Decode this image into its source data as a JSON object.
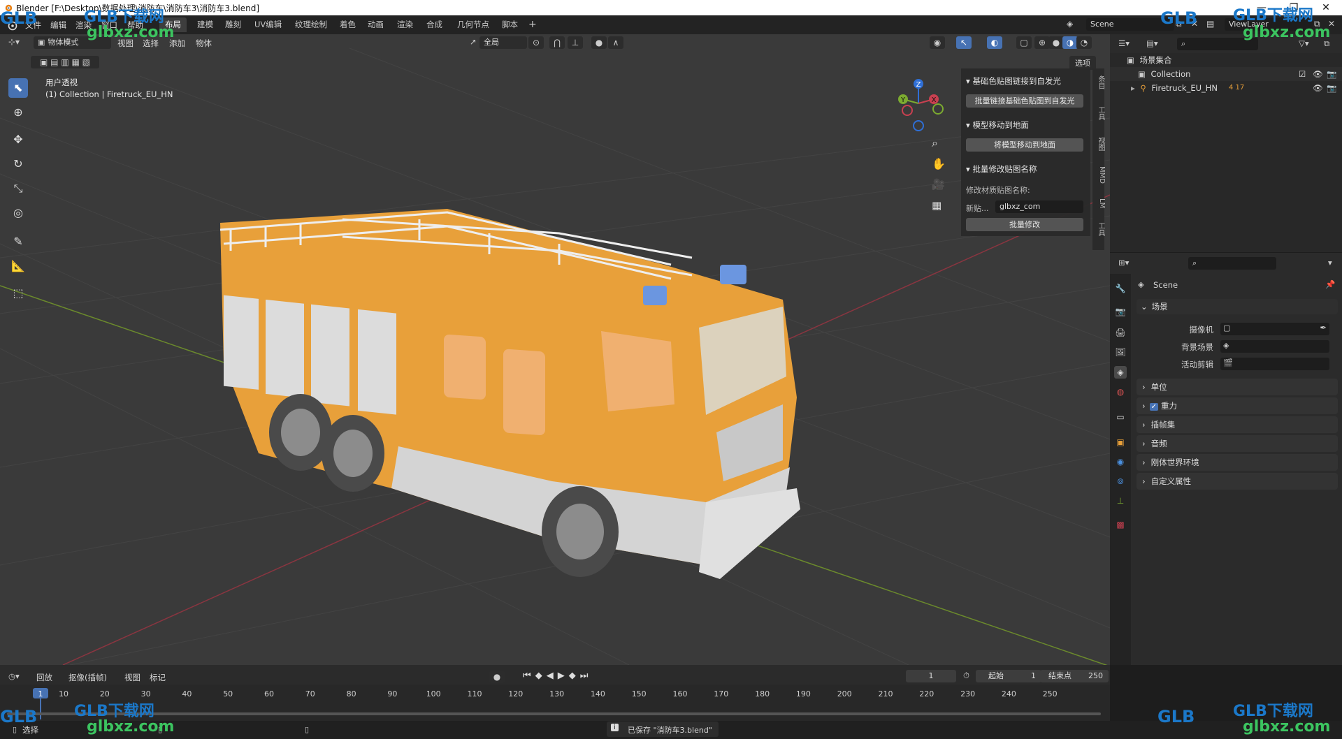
{
  "window": {
    "title": "Blender [F:\\Desktop\\数据处理\\消防车\\消防车3\\消防车3.blend]",
    "controls": [
      "—",
      "❐",
      "✕"
    ]
  },
  "menu": [
    "文件",
    "编辑",
    "渲染",
    "窗口",
    "帮助"
  ],
  "workspaces": [
    "布局",
    "建模",
    "雕刻",
    "UV编辑",
    "纹理绘制",
    "着色",
    "动画",
    "渲染",
    "合成",
    "几何节点",
    "脚本"
  ],
  "workspace_add": "+",
  "scene_name": "Scene",
  "view_layer": "ViewLayer",
  "viewport_header": {
    "mode": "物体模式",
    "menus": [
      "视图",
      "选择",
      "添加",
      "物体"
    ],
    "transform_orientation": "全局",
    "options": "选项"
  },
  "viewport": {
    "view_name": "用户透视",
    "collection_info": "(1) Collection | Firetruck_EU_HN",
    "gizmo_axes": [
      "Z",
      "Y",
      "X"
    ]
  },
  "n_panel": {
    "tabs": [
      "条目",
      "工具",
      "视图",
      "MMD",
      "LM",
      "工具"
    ],
    "sections": [
      {
        "title": "基础色贴图链接到自发光",
        "button": "批量链接基础色贴图到自发光"
      },
      {
        "title": "模型移动到地面",
        "button": "将模型移动到地面"
      },
      {
        "title": "批量修改贴图名称",
        "label": "修改材质贴图名称:",
        "field_label": "新贴...",
        "field_value": "glbxz_com",
        "button": "批量修改"
      }
    ]
  },
  "outliner": {
    "root": "场景集合",
    "items": [
      {
        "name": "Collection",
        "badge": ""
      },
      {
        "name": "Firetruck_EU_HN",
        "badge": "4 17"
      }
    ]
  },
  "properties": {
    "context": "Scene",
    "scene_section": "场景",
    "fields": [
      {
        "label": "摄像机",
        "value": ""
      },
      {
        "label": "背景场景",
        "value": ""
      },
      {
        "label": "活动剪辑",
        "value": ""
      }
    ],
    "sections": [
      "单位",
      "重力",
      "插帧集",
      "音频",
      "刚体世界环境",
      "自定义属性"
    ]
  },
  "timeline": {
    "playback": "回放",
    "keying": "抠像(插帧)",
    "view": "视图",
    "marker": "标记",
    "current_frame": "1",
    "start_label": "起始",
    "start": "1",
    "end_label": "结束点",
    "end": "250",
    "ticks": [
      "1",
      "10",
      "20",
      "30",
      "40",
      "50",
      "60",
      "70",
      "80",
      "90",
      "100",
      "110",
      "120",
      "130",
      "140",
      "150",
      "160",
      "170",
      "180",
      "190",
      "200",
      "210",
      "220",
      "230",
      "240",
      "250"
    ]
  },
  "status": {
    "left": "选择",
    "message": "已保存 \"消防车3.blend\""
  },
  "watermark": {
    "brand": "GLB下载网",
    "site": "glbxz.com",
    "logo": "GLB"
  },
  "colors": {
    "accent": "#4772b3",
    "truck_body": "#e8a03a",
    "axis_x": "#c94050",
    "axis_y": "#7cab30",
    "axis_z": "#2f6fd6"
  }
}
